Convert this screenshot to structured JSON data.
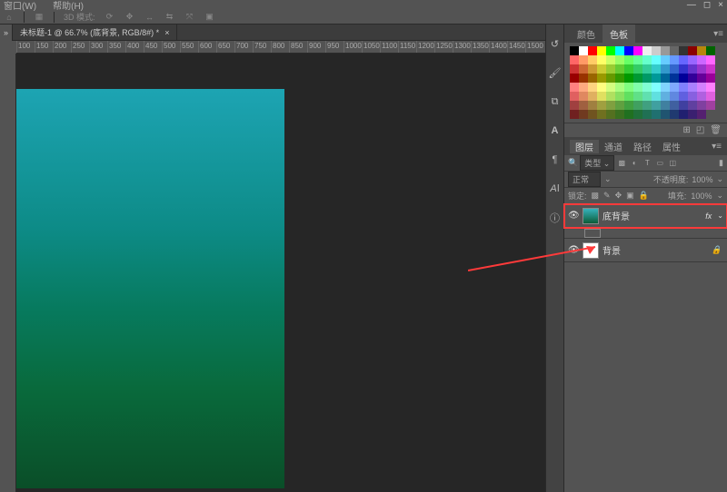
{
  "menu": {
    "window": "窗口(W)",
    "help": "帮助(H)"
  },
  "toolbar": {
    "mode3d": "3D 模式:"
  },
  "tab": {
    "title": "未标题-1 @ 66.7% (底背景, RGB/8#) *"
  },
  "ruler_ticks": [
    100,
    150,
    200,
    250,
    300,
    350,
    400,
    450,
    500,
    550,
    600,
    650,
    700,
    750,
    800,
    850,
    900,
    950,
    1000,
    1050,
    1100,
    1150,
    1200,
    1250,
    1300,
    1350,
    1400,
    1450,
    1500
  ],
  "swatch_panel": {
    "tab_color": "颜色",
    "tab_swatch": "色板"
  },
  "layers_panel": {
    "tab_layers": "图层",
    "tab_channels": "通道",
    "tab_paths": "路径",
    "tab_props": "属性",
    "type_label": "类型",
    "blend": "正常",
    "opacity_label": "不透明度:",
    "opacity_val": "100%",
    "lock_label": "锁定:",
    "fill_label": "填充:",
    "fill_val": "100%",
    "layer1": "底背景",
    "layer1_fx": "fx",
    "layer2": "背景"
  },
  "swatch_colors": [
    "#000000",
    "#ffffff",
    "#ff0000",
    "#ffff00",
    "#00ff00",
    "#00ffff",
    "#0000ff",
    "#ff00ff",
    "#eeeeee",
    "#cccccc",
    "#999999",
    "#666666",
    "#333333",
    "#8b0000",
    "#b8860b",
    "#006400",
    "#ff6666",
    "#ff9966",
    "#ffcc66",
    "#ffff66",
    "#ccff66",
    "#99ff66",
    "#66ff66",
    "#66ff99",
    "#66ffcc",
    "#66ffff",
    "#66ccff",
    "#6699ff",
    "#6666ff",
    "#9966ff",
    "#cc66ff",
    "#ff66ff",
    "#cc3333",
    "#cc6633",
    "#cc9933",
    "#cccc33",
    "#99cc33",
    "#66cc33",
    "#33cc33",
    "#33cc66",
    "#33cc99",
    "#33cccc",
    "#3399cc",
    "#3366cc",
    "#3333cc",
    "#6633cc",
    "#9933cc",
    "#cc33cc",
    "#990000",
    "#993300",
    "#996600",
    "#999900",
    "#669900",
    "#339900",
    "#009900",
    "#009933",
    "#009966",
    "#009999",
    "#006699",
    "#003399",
    "#000099",
    "#330099",
    "#660099",
    "#990099",
    "#ff8080",
    "#ffaa80",
    "#ffd480",
    "#ffff80",
    "#d4ff80",
    "#aaff80",
    "#80ff80",
    "#80ffaa",
    "#80ffd4",
    "#80ffff",
    "#80d4ff",
    "#80aaff",
    "#8080ff",
    "#aa80ff",
    "#d480ff",
    "#ff80ff",
    "#e06060",
    "#e08860",
    "#e0b060",
    "#e0e060",
    "#b0e060",
    "#88e060",
    "#60e060",
    "#60e088",
    "#60e0b0",
    "#60e0e0",
    "#60b0e0",
    "#6088e0",
    "#6060e0",
    "#8860e0",
    "#b060e0",
    "#e060e0",
    "#a04040",
    "#a06040",
    "#a08040",
    "#a0a040",
    "#80a040",
    "#60a040",
    "#40a040",
    "#40a060",
    "#40a080",
    "#40a0a0",
    "#4080a0",
    "#4060a0",
    "#4040a0",
    "#6040a0",
    "#8040a0",
    "#a040a0",
    "#702020",
    "#703a20",
    "#705420",
    "#707020",
    "#547020",
    "#3a7020",
    "#207020",
    "#20703a",
    "#207054",
    "#207070",
    "#205470",
    "#203a70",
    "#202070",
    "#3a2070",
    "#542070"
  ]
}
